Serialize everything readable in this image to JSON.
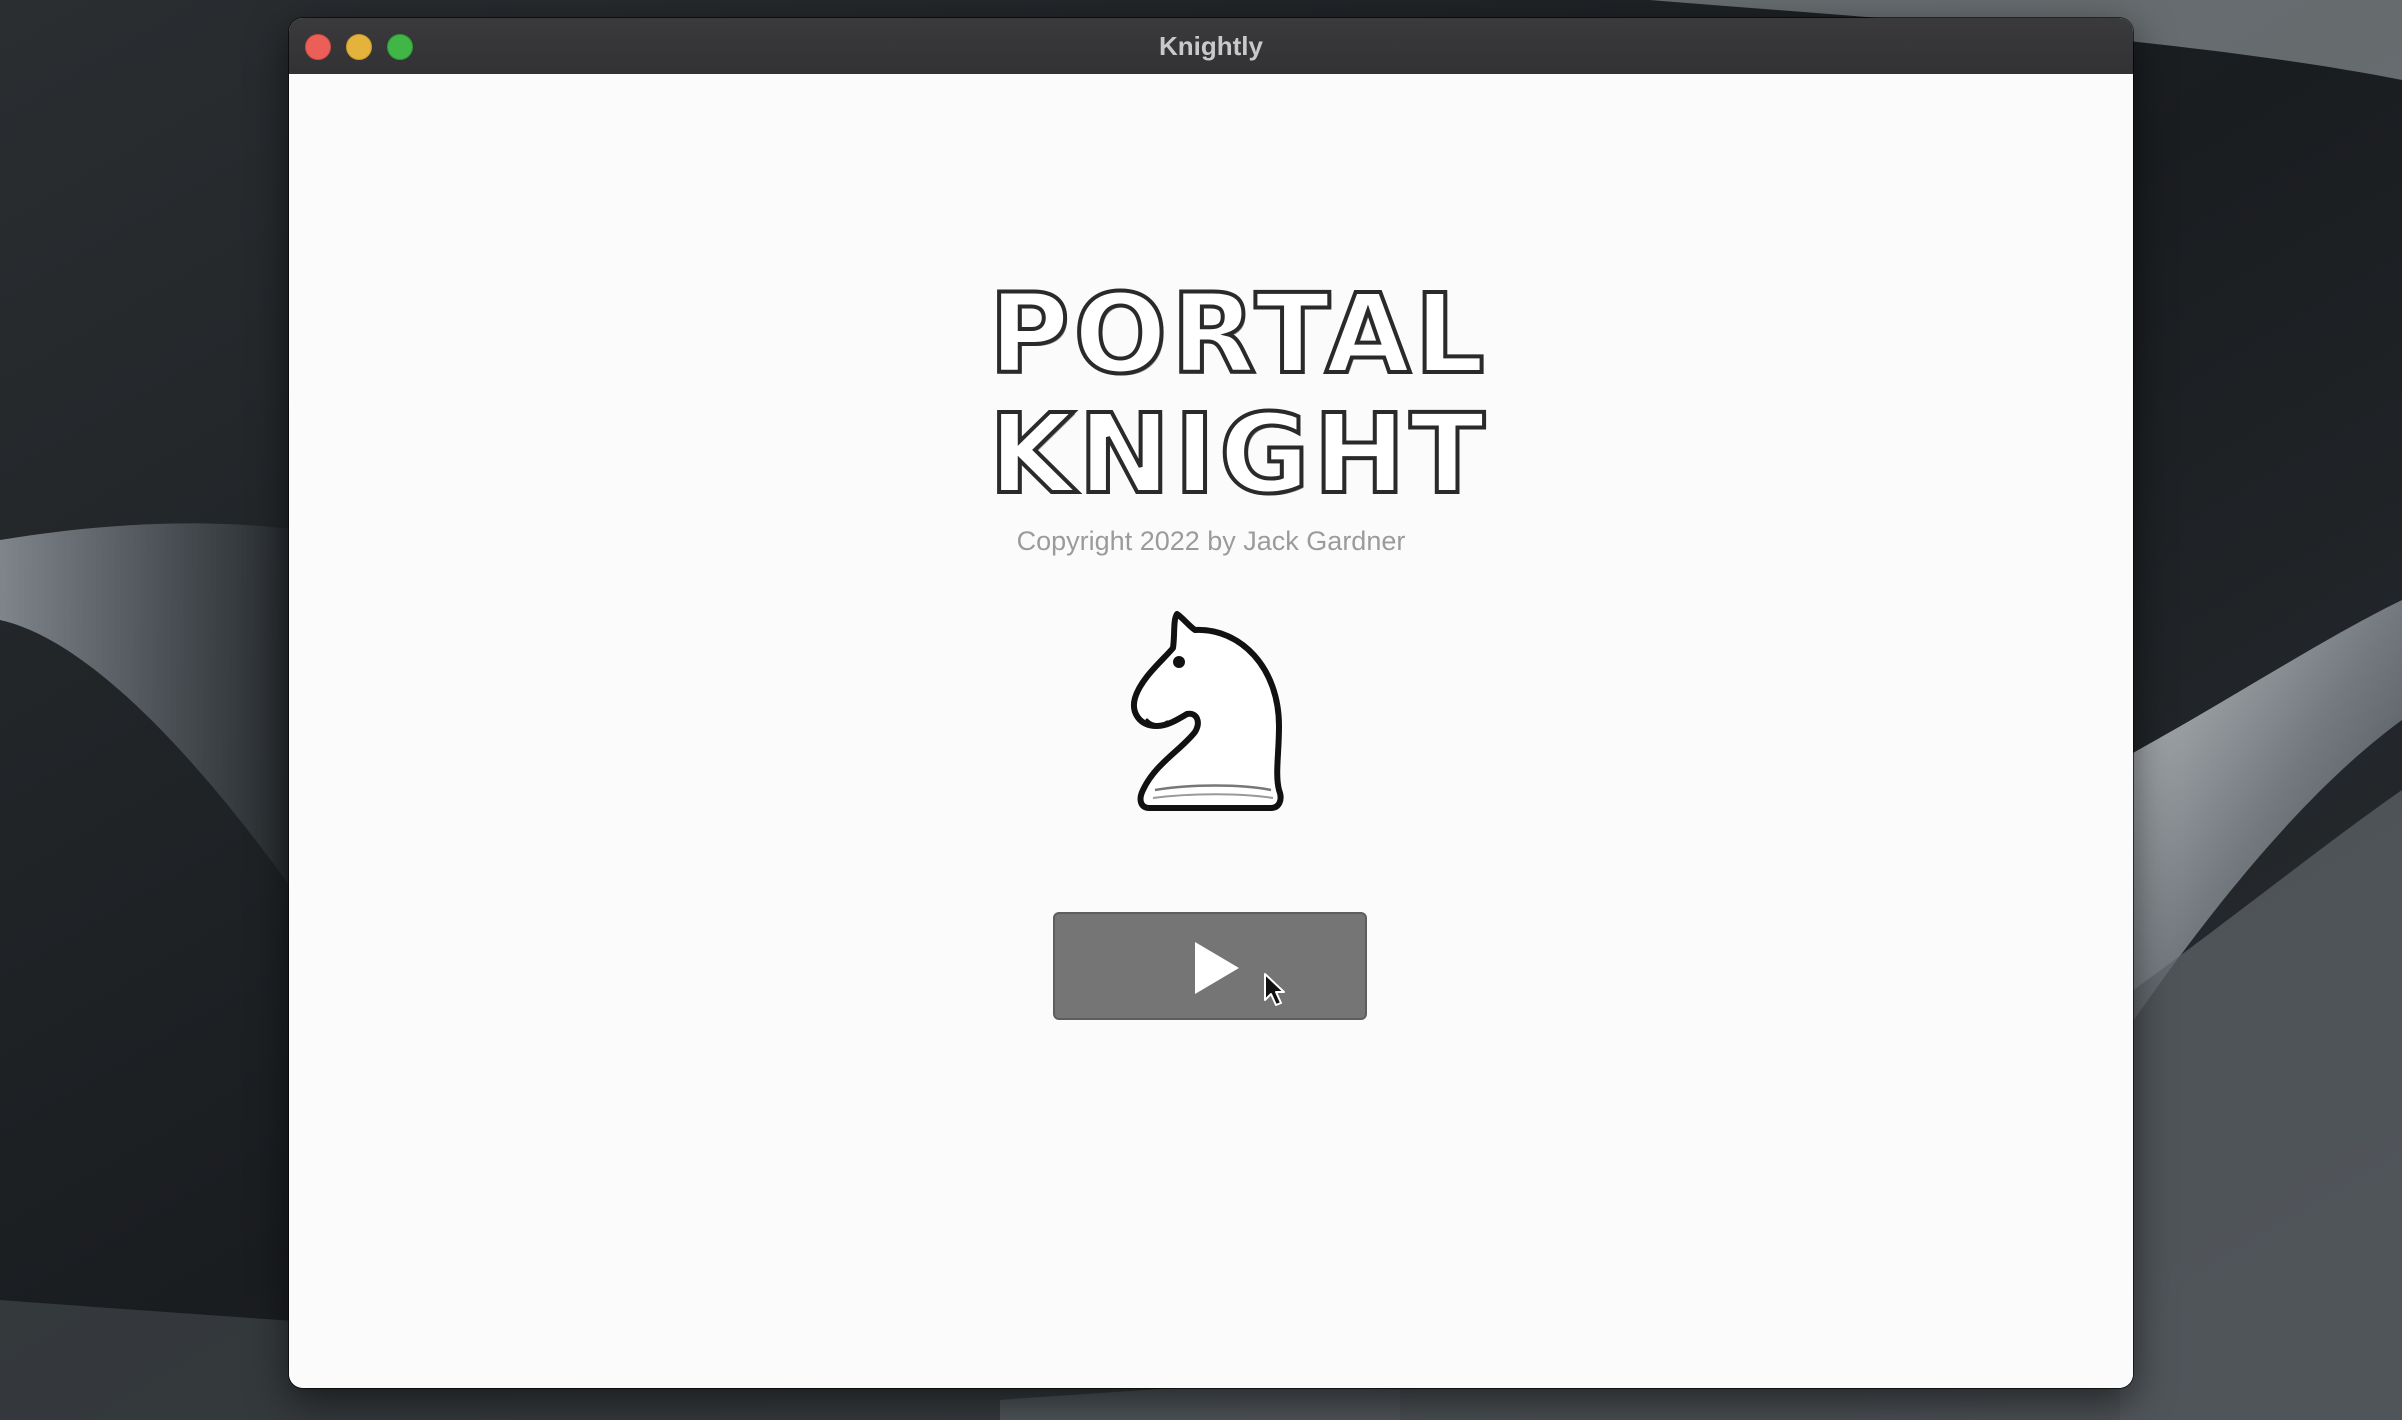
{
  "window": {
    "title": "Knightly",
    "controls": [
      "close",
      "minimize",
      "zoom"
    ]
  },
  "game": {
    "logo_line_1": "PORTAL",
    "logo_line_2": "KNIGHT",
    "copyright": "Copyright 2022 by Jack Gardner",
    "hero_icon": "chess-knight-icon",
    "play_button_icon": "play-icon"
  },
  "colors": {
    "play_button": "#757575",
    "copyright_text": "#9b9b9b",
    "window_background": "#fbfbfb",
    "titlebar": "#353537"
  }
}
